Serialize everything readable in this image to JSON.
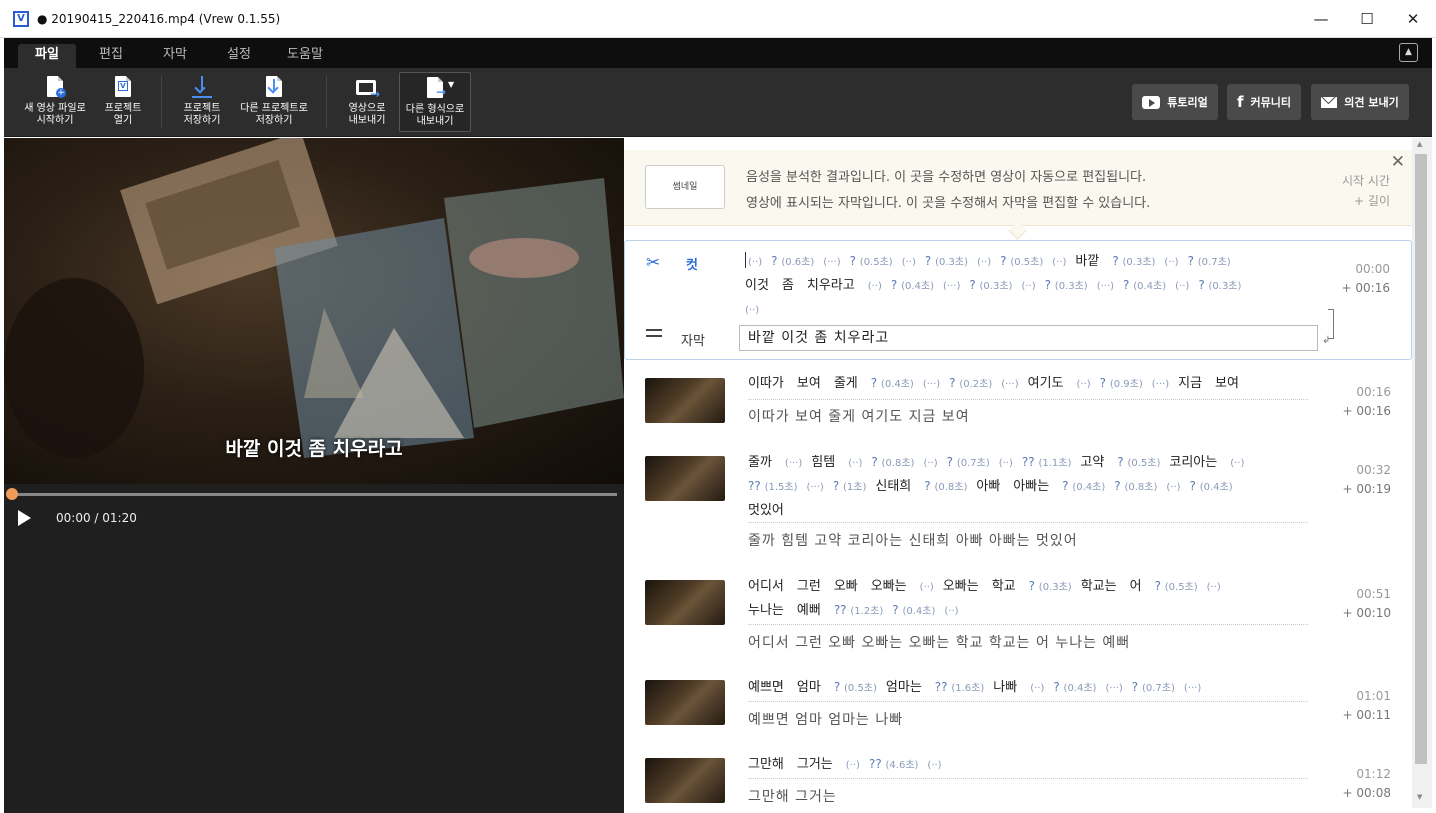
{
  "window": {
    "app_icon_letter": "V",
    "title": "● 20190415_220416.mp4 (Vrew 0.1.55)",
    "controls": {
      "minimize": "—",
      "maximize": "☐",
      "close": "✕"
    }
  },
  "menu": {
    "tabs": [
      "파일",
      "편집",
      "자막",
      "설정",
      "도움말"
    ],
    "active_tab": "파일",
    "collapse_icon": "▲"
  },
  "toolbar": {
    "buttons": [
      {
        "id": "new",
        "label1": "새 영상 파일로",
        "label2": "시작하기",
        "icon": "new-file-icon"
      },
      {
        "id": "open",
        "label1": "프로젝트",
        "label2": "열기",
        "icon": "open-project-icon"
      },
      {
        "id": "save",
        "label1": "프로젝트",
        "label2": "저장하기",
        "icon": "save-icon"
      },
      {
        "id": "saveas",
        "label1": "다른 프로젝트로",
        "label2": "저장하기",
        "icon": "save-as-icon"
      },
      {
        "id": "export-video",
        "label1": "영상으로",
        "label2": "내보내기",
        "icon": "export-video-icon"
      },
      {
        "id": "export-other",
        "label1": "다른 형식으로",
        "label2": "내보내기",
        "icon": "export-format-icon"
      }
    ],
    "right_buttons": {
      "tutorial": "튜토리얼",
      "community": "커뮤니티",
      "feedback": "의견 보내기"
    }
  },
  "player": {
    "subtitle_overlay": "바깥 이것 좀 치우라고",
    "time_current": "00:00",
    "time_total": "01:20",
    "timecode": "00:00 / 01:20",
    "progress_fraction": 0.0
  },
  "info_panel": {
    "thumbnail_label": "썸네일",
    "line1": "음성을 분석한 결과입니다. 이 곳을 수정하면 영상이 자동으로 편집됩니다.",
    "line2": "영상에 표시되는 자막입니다. 이 곳을 수정해서 자막을 편집할 수 있습니다.",
    "start_time_label": "시작 시간",
    "length_label": "+ 길이",
    "close": "✕"
  },
  "active_clip": {
    "cut_label": "컷",
    "subtitle_label": "자막",
    "subtitle_value": "바깥 이것 좀 치우라고",
    "start": "00:00",
    "length": "+ 00:16"
  },
  "clips": [
    {
      "start": "00:16",
      "length": "+ 00:16",
      "subtitle": "이따가 보여 줄게 여기도 지금 보여"
    },
    {
      "start": "00:32",
      "length": "+ 00:19",
      "subtitle": "줄까 힘템 고약 코리아는 신태희 아빠 아빠는 멋있어"
    },
    {
      "start": "00:51",
      "length": "+ 00:10",
      "subtitle": "어디서 그런 오빠 오빠는 오빠는 학교 학교는 어 누나는 예뻐"
    },
    {
      "start": "01:01",
      "length": "+ 00:11",
      "subtitle": "예쁘면 엄마 엄마는 나빠"
    },
    {
      "start": "01:12",
      "length": "+ 00:08",
      "subtitle": "그만해 그거는"
    }
  ],
  "transcript": {
    "active_l1": [
      "(··)",
      "?|(0.6초)",
      "(···)",
      "?|(0.5초)",
      "(··)",
      "?|(0.3초)",
      "(··)",
      "?|(0.5초)",
      "(··)",
      "#바깥",
      "?|(0.3초)",
      "(··)",
      "?|(0.7초)"
    ],
    "active_l2": [
      "#이것",
      "#좀",
      "#치우라고",
      "(··)",
      "?|(0.4초)",
      "(···)",
      "?|(0.3초)",
      "(··)",
      "?|(0.3초)",
      "(···)",
      "?|(0.4초)",
      "(··)",
      "?|(0.3초)"
    ],
    "active_l3": [
      "(··)"
    ],
    "c1": [
      "#이따가",
      "#보여",
      "#줄게",
      "?|(0.4초)",
      "(···)",
      "?|(0.2초)",
      "(···)",
      "#여기도",
      "(··)",
      "?|(0.9초)",
      "(···)",
      "#지금",
      "#보여"
    ],
    "c2_l1": [
      "#줄까",
      "(···)",
      "#힘템",
      "(··)",
      "?|(0.8초)",
      "(··)",
      "?|(0.7초)",
      "(··)",
      "??|(1.1초)",
      "#고약",
      "?|(0.5초)",
      "#코리아는",
      "(··)"
    ],
    "c2_l2": [
      "??|(1.5초)",
      "(···)",
      "?|(1초)",
      "#신태희",
      "?|(0.8초)",
      "#아빠",
      "#아빠는",
      "?|(0.4초)",
      "?|(0.8초)",
      "(··)",
      "?|(0.4초)"
    ],
    "c2_l3": [
      "#멋있어"
    ],
    "c3_l1": [
      "#어디서",
      "#그런",
      "#오빠",
      "#오빠는",
      "(··)",
      "#오빠는",
      "#학교",
      "?|(0.3초)",
      "#학교는",
      "#어",
      "?|(0.5초)",
      "(··)"
    ],
    "c3_l2": [
      "#누나는",
      "#예뻐",
      "??|(1.2초)",
      "?|(0.4초)",
      "(··)"
    ],
    "c4": [
      "#예쁘면",
      "#엄마",
      "?|(0.5초)",
      "#엄마는",
      "??|(1.6초)",
      "#나빠",
      "(··)",
      "?|(0.4초)",
      "(···)",
      "?|(0.7초)",
      "(···)"
    ],
    "c5": [
      "#그만해",
      "#그거는",
      "(··)",
      "??|(4.6초)",
      "(··)"
    ]
  },
  "colors": {
    "accent": "#2a6ed8",
    "progress_knob": "#f09b57",
    "toolbar_bg": "#2d2d2d",
    "menubar_bg": "#0e0e0e"
  }
}
